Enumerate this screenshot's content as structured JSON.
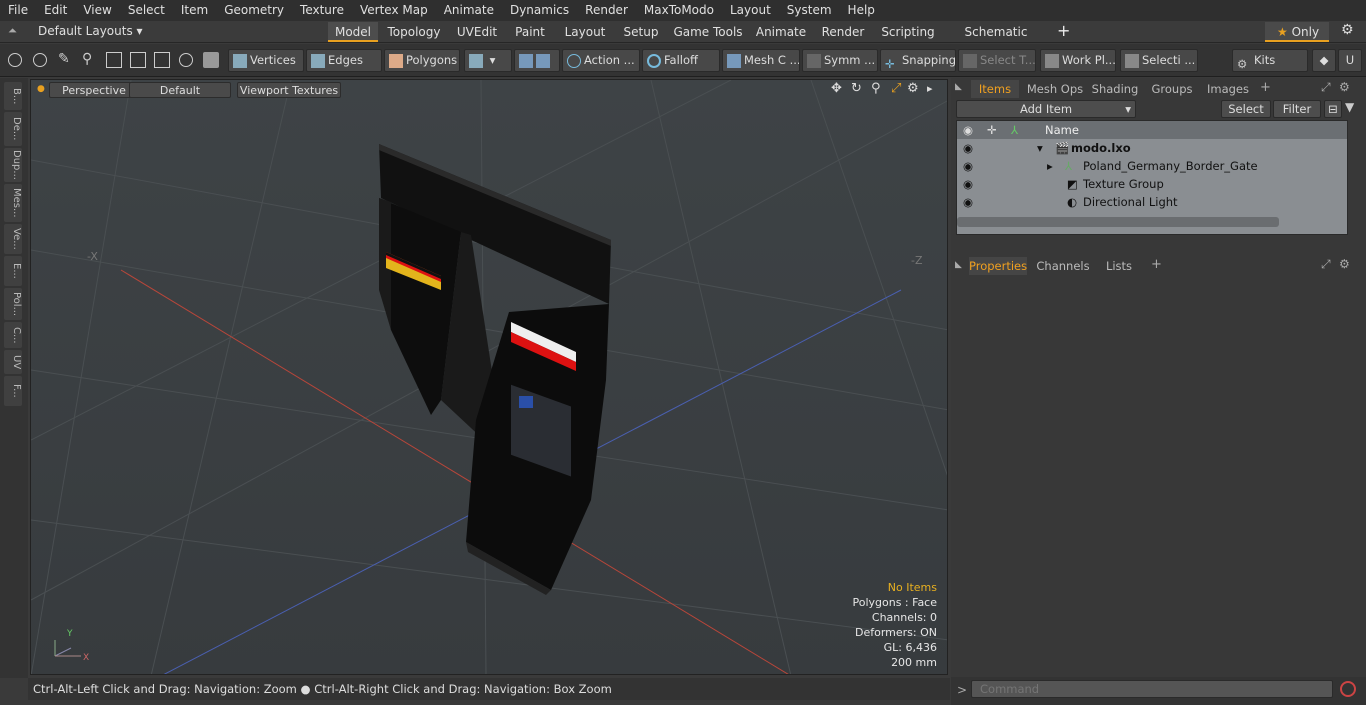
{
  "menu": [
    "File",
    "Edit",
    "View",
    "Select",
    "Item",
    "Geometry",
    "Texture",
    "Vertex Map",
    "Animate",
    "Dynamics",
    "Render",
    "MaxToModo",
    "Layout",
    "System",
    "Help"
  ],
  "layoutbar": {
    "layouts_label": "Default Layouts",
    "tabs": [
      "Model",
      "Topology",
      "UVEdit",
      "Paint",
      "Layout",
      "Setup",
      "Game Tools",
      "Animate",
      "Render",
      "Scripting",
      "Schematic Fusion"
    ],
    "active_tab": "Model",
    "only_label": "Only"
  },
  "toolbar": {
    "vertices": "Vertices",
    "edges": "Edges",
    "polygons": "Polygons",
    "action": "Action ...",
    "falloff": "Falloff",
    "mesh": "Mesh C ...",
    "symm": "Symm ...",
    "snapping": "Snapping",
    "select_t": "Select T...",
    "work_pl": "Work Pl...",
    "selecti": "Selecti ...",
    "kits": "Kits"
  },
  "leftstrip": [
    "B...",
    "De...",
    "Dup...",
    "Mes...",
    "Ve...",
    "E...",
    "Pol...",
    "C...",
    "UV",
    "F..."
  ],
  "viewport": {
    "perspective": "Perspective",
    "default": "Default",
    "textures": "Viewport Textures",
    "axis_x_neg": "-X",
    "axis_z_neg": "-Z",
    "info": {
      "no_items": "No Items",
      "polygons": "Polygons : Face",
      "channels": "Channels: 0",
      "deformers": "Deformers: ON",
      "gl": "GL: 6,436",
      "size": "200 mm"
    }
  },
  "status": "Ctrl-Alt-Left Click and Drag: Navigation: Zoom ● Ctrl-Alt-Right Click and Drag: Navigation: Box Zoom",
  "items_panel": {
    "tabs": [
      "Items",
      "Mesh Ops",
      "Shading",
      "Groups",
      "Images"
    ],
    "add_item": "Add Item",
    "select": "Select",
    "filter": "Filter",
    "name_col": "Name",
    "rows": [
      {
        "label": "modo.lxo"
      },
      {
        "label": "Poland_Germany_Border_Gate"
      },
      {
        "label": "Texture Group"
      },
      {
        "label": "Directional Light"
      }
    ]
  },
  "props_panel": {
    "tabs": [
      "Properties",
      "Channels",
      "Lists"
    ]
  },
  "command": {
    "placeholder": "Command"
  },
  "colors": {
    "accent": "#e8a020",
    "viewport": "#3b4044"
  }
}
